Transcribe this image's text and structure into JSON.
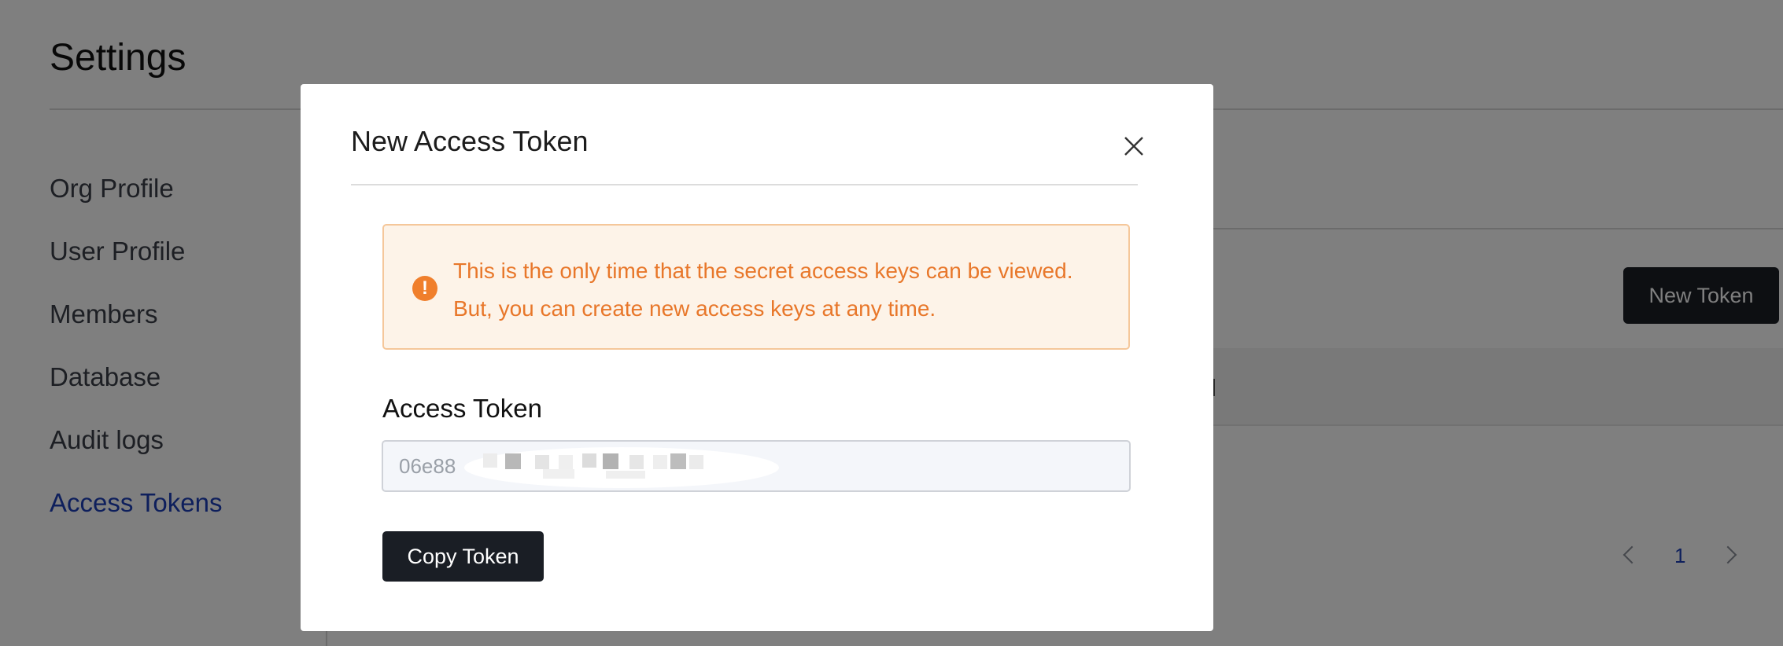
{
  "settings": {
    "title": "Settings",
    "sidebar": {
      "items": [
        {
          "label": "Org Profile"
        },
        {
          "label": "User Profile"
        },
        {
          "label": "Members"
        },
        {
          "label": "Database"
        },
        {
          "label": "Audit logs"
        },
        {
          "label": "Access Tokens",
          "active": true
        }
      ]
    },
    "new_token_label": "New Token",
    "pagination": {
      "current_page": "1"
    }
  },
  "modal": {
    "title": "New Access Token",
    "warning": {
      "icon": "exclamation-circle-icon",
      "text": "This is the only time that the secret access keys can be viewed. But, you can create new access keys at any time."
    },
    "token_field": {
      "label": "Access Token",
      "value": "06e88"
    },
    "copy_label": "Copy Token"
  },
  "colors": {
    "overlay": "rgba(0,0,0,0.5)",
    "warning_text": "#e8772a",
    "warning_bg": "#fdf3e8",
    "warning_border": "#f5c79a",
    "active_link": "#1d3fb8",
    "dark_button": "#1a1e25"
  }
}
